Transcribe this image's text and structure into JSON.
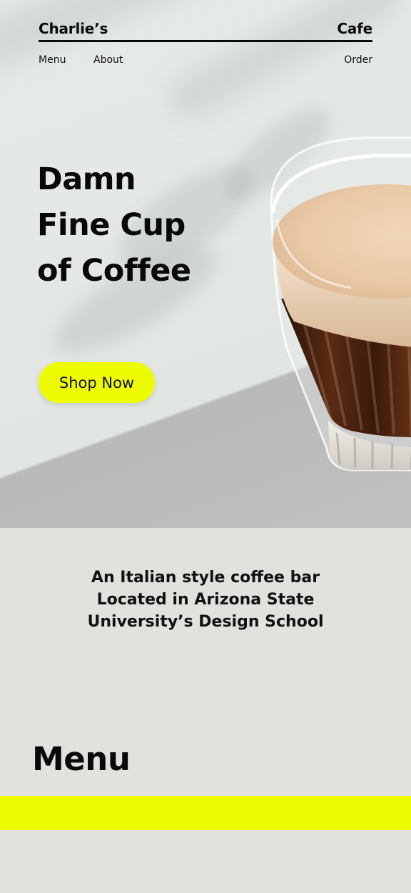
{
  "header": {
    "brand_left": "Charlie’s",
    "brand_right": "Cafe"
  },
  "nav": {
    "items": [
      {
        "label": "Menu"
      },
      {
        "label": "About"
      },
      {
        "label": "Order"
      }
    ]
  },
  "hero": {
    "headline_lines": [
      "Damn",
      "Fine Cup",
      "of Coffee"
    ],
    "cta_label": "Shop Now",
    "image": "glass-of-coffee-photo"
  },
  "about": {
    "tagline_lines": [
      "An Italian style coffee bar",
      "Located in Arizona State",
      "University’s Design School"
    ]
  },
  "menu_section": {
    "title": "Menu"
  },
  "colors": {
    "accent": "#eefc00",
    "text": "#0b0b0b",
    "background": "#e3e1dd",
    "hero_bg": "#e4e9e6"
  }
}
